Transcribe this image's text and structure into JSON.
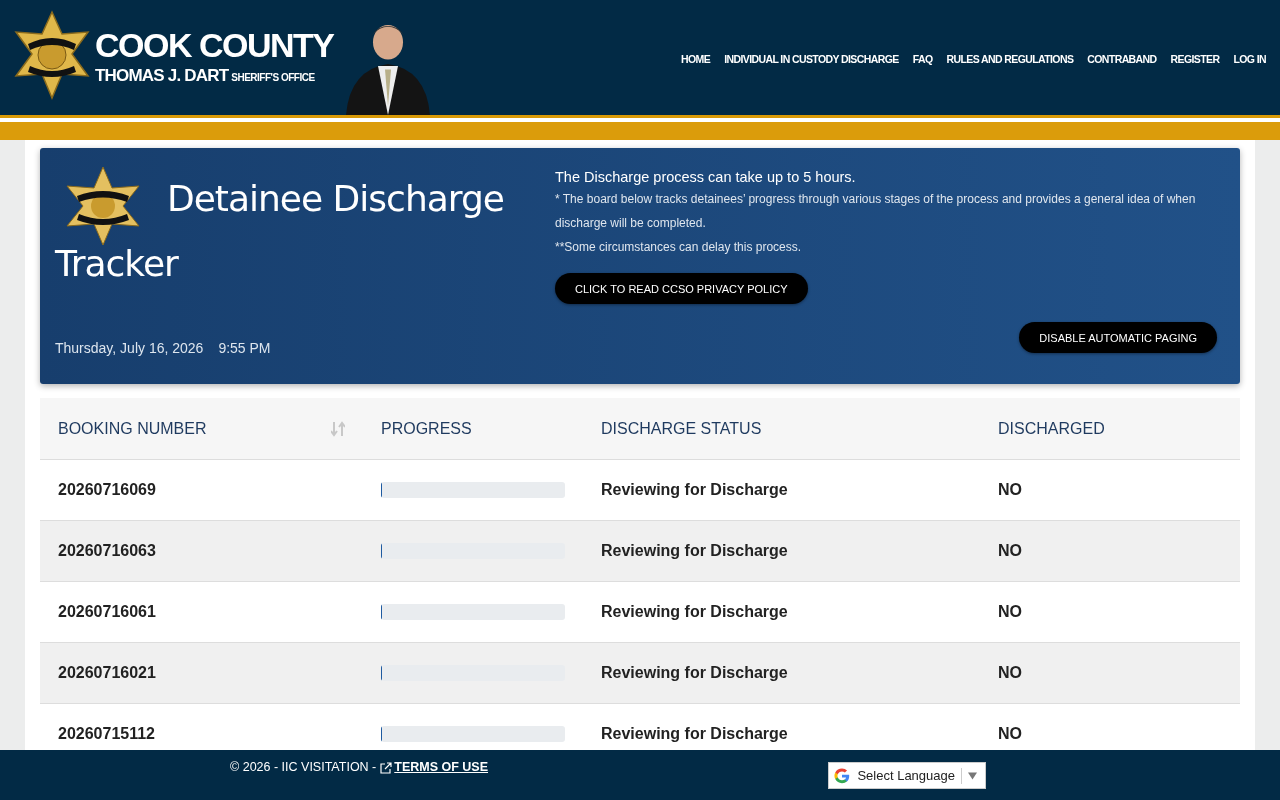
{
  "header": {
    "logo_title": "COOK COUNTY",
    "logo_subtitle": "THOMAS J. DART",
    "logo_office": "SHERIFF'S OFFICE",
    "nav": [
      {
        "label": "HOME"
      },
      {
        "label": "INDIVIDUAL IN CUSTODY DISCHARGE"
      },
      {
        "label": "FAQ"
      },
      {
        "label": "RULES AND REGULATIONS"
      },
      {
        "label": "CONTRABAND"
      },
      {
        "label": "REGISTER"
      },
      {
        "label": "LOG IN"
      }
    ]
  },
  "banner": {
    "title": "Detainee Discharge Tracker",
    "date": "Thursday, July 16, 2026",
    "time": "9:55 PM",
    "notes": [
      "The Discharge process can take up to 5 hours.",
      "* The board below tracks detainees’ progress through various stages of the process and provides a general idea of when discharge will be completed.",
      "**Some circumstances can delay this process."
    ],
    "privacy_button": "CLICK TO READ CCSO PRIVACY POLICY",
    "paging_button": "DISABLE AUTOMATIC PAGING"
  },
  "table": {
    "columns": [
      {
        "label": "BOOKING NUMBER",
        "sortable": true
      },
      {
        "label": "PROGRESS",
        "sortable": false
      },
      {
        "label": "DISCHARGE STATUS",
        "sortable": false
      },
      {
        "label": "DISCHARGED",
        "sortable": false
      }
    ],
    "rows": [
      {
        "booking": "20260716069",
        "level": 0,
        "status": "Reviewing for Discharge",
        "discharged": "NO"
      },
      {
        "booking": "20260716063",
        "level": 0,
        "status": "Reviewing for Discharge",
        "discharged": "NO"
      },
      {
        "booking": "20260716061",
        "level": 0,
        "status": "Reviewing for Discharge",
        "discharged": "NO"
      },
      {
        "booking": "20260716021",
        "level": 0,
        "status": "Reviewing for Discharge",
        "discharged": "NO"
      },
      {
        "booking": "20260715112",
        "level": 0,
        "status": "Reviewing for Discharge",
        "discharged": "NO"
      }
    ]
  },
  "footer": {
    "copyright": "© 2026 - IIC VISITATION -",
    "terms_link": "TERMS OF USE",
    "language_select": "Select Language"
  }
}
